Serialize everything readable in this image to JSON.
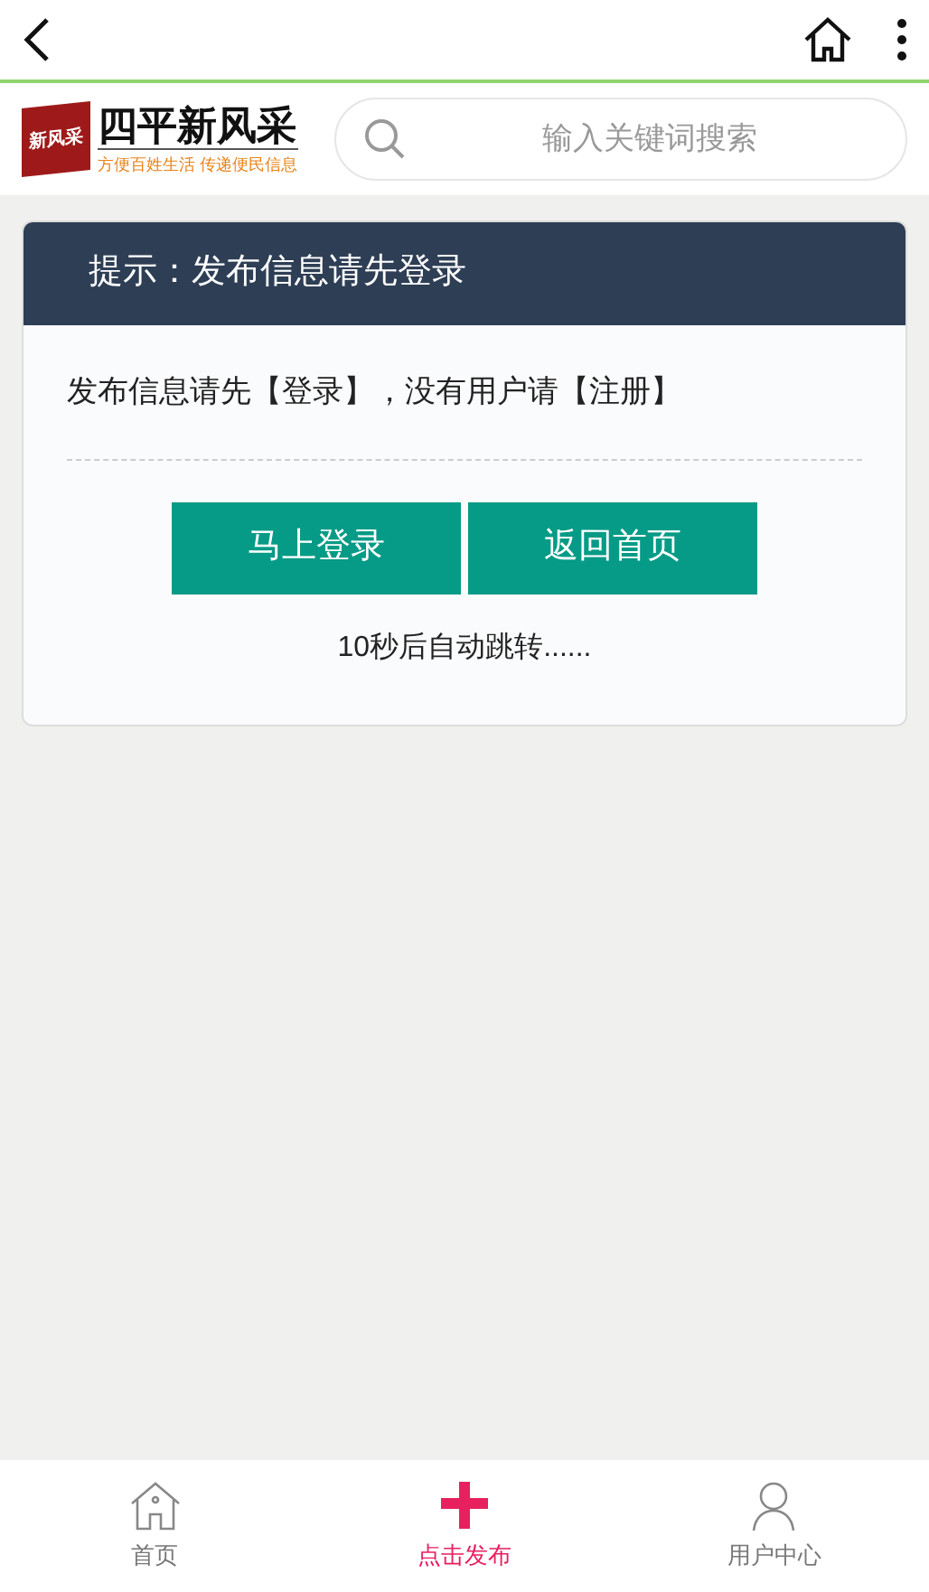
{
  "logo": {
    "badge": "新风采",
    "name": "四平新风采",
    "slogan": "方便百姓生活 传递便民信息"
  },
  "search": {
    "placeholder": "输入关键词搜索"
  },
  "notice": {
    "title": "提示：发布信息请先登录",
    "message": "发布信息请先【登录】，没有用户请【注册】",
    "buttons": [
      "马上登录",
      "返回首页"
    ],
    "countdown": "10秒后自动跳转......"
  },
  "bottom_nav": [
    {
      "label": "首页",
      "kind": "home",
      "selected": false
    },
    {
      "label": "点击发布",
      "kind": "plus",
      "selected": true
    },
    {
      "label": "用户中心",
      "kind": "user",
      "selected": false
    }
  ]
}
